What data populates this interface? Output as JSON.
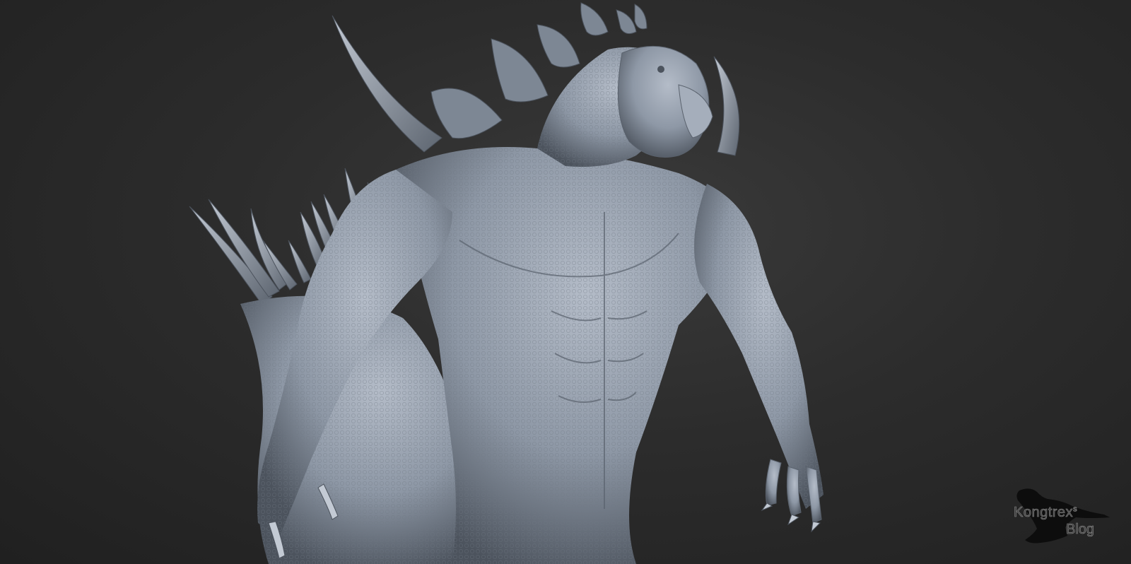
{
  "watermark": {
    "name": "Kongtrex",
    "superscript": "s",
    "line2": "Blog"
  },
  "colors": {
    "background": "#2a2a2a",
    "clay": "#8e98a6",
    "clay_highlight": "#b4bcc8",
    "clay_shadow": "#4c535d"
  }
}
